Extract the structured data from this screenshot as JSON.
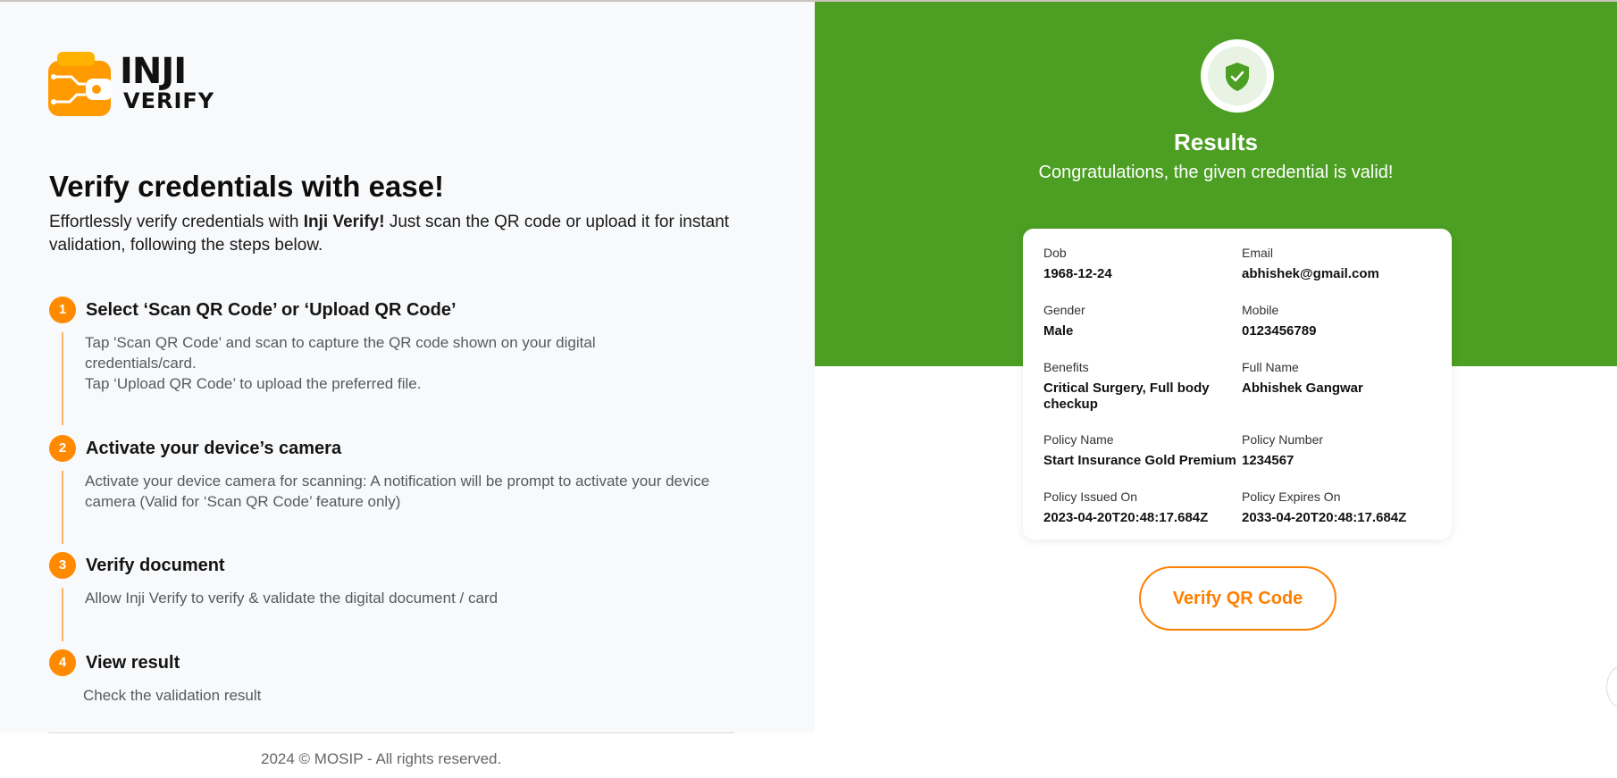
{
  "brand": {
    "logo_line1": "INJI",
    "logo_line2": "VERIFY",
    "logo_icon": "wallet-circuit-icon",
    "accent": "#ff8a00",
    "green": "#4c9f22"
  },
  "hero": {
    "title": "Verify credentials with ease!",
    "desc_prefix": "Effortlessly verify credentials with ",
    "desc_bold": "Inji Verify!",
    "desc_suffix": " Just scan the QR code or upload it for instant validation, following the steps below."
  },
  "steps": [
    {
      "number": "1",
      "title": "Select ‘Scan QR Code’ or ‘Upload QR Code’",
      "desc_line1": "Tap 'Scan QR Code' and scan to capture the QR code shown on your digital credentials/card.",
      "desc_line2": "Tap ‘Upload QR Code’ to upload the preferred file."
    },
    {
      "number": "2",
      "title": "Activate your device’s camera",
      "desc_line1": "Activate your device camera for scanning: A notification will be prompt to activate your device camera (Valid for ‘Scan QR Code’ feature only)"
    },
    {
      "number": "3",
      "title": "Verify document",
      "desc_line1": "Allow Inji Verify to verify & validate the digital document / card"
    },
    {
      "number": "4",
      "title": "View result",
      "desc_line1": "Check the validation result"
    }
  ],
  "footer": {
    "text": "2024 © MOSIP - All rights reserved."
  },
  "results": {
    "icon": "shield-check-icon",
    "title": "Results",
    "subtitle": "Congratulations, the given credential is valid!",
    "fields": [
      {
        "label": "Dob",
        "value": "1968-12-24"
      },
      {
        "label": "Email",
        "value": "abhishek@gmail.com"
      },
      {
        "label": "Gender",
        "value": "Male"
      },
      {
        "label": "Mobile",
        "value": "0123456789"
      },
      {
        "label": "Benefits",
        "value": "Critical Surgery, Full body checkup"
      },
      {
        "label": "Full Name",
        "value": "Abhishek Gangwar"
      },
      {
        "label": "Policy Name",
        "value": "Start Insurance Gold Premium"
      },
      {
        "label": "Policy Number",
        "value": "1234567"
      },
      {
        "label": "Policy Issued On",
        "value": "2023-04-20T20:48:17.684Z"
      },
      {
        "label": "Policy Expires On",
        "value": "2033-04-20T20:48:17.684Z"
      }
    ],
    "verify_button": "Verify QR Code"
  }
}
